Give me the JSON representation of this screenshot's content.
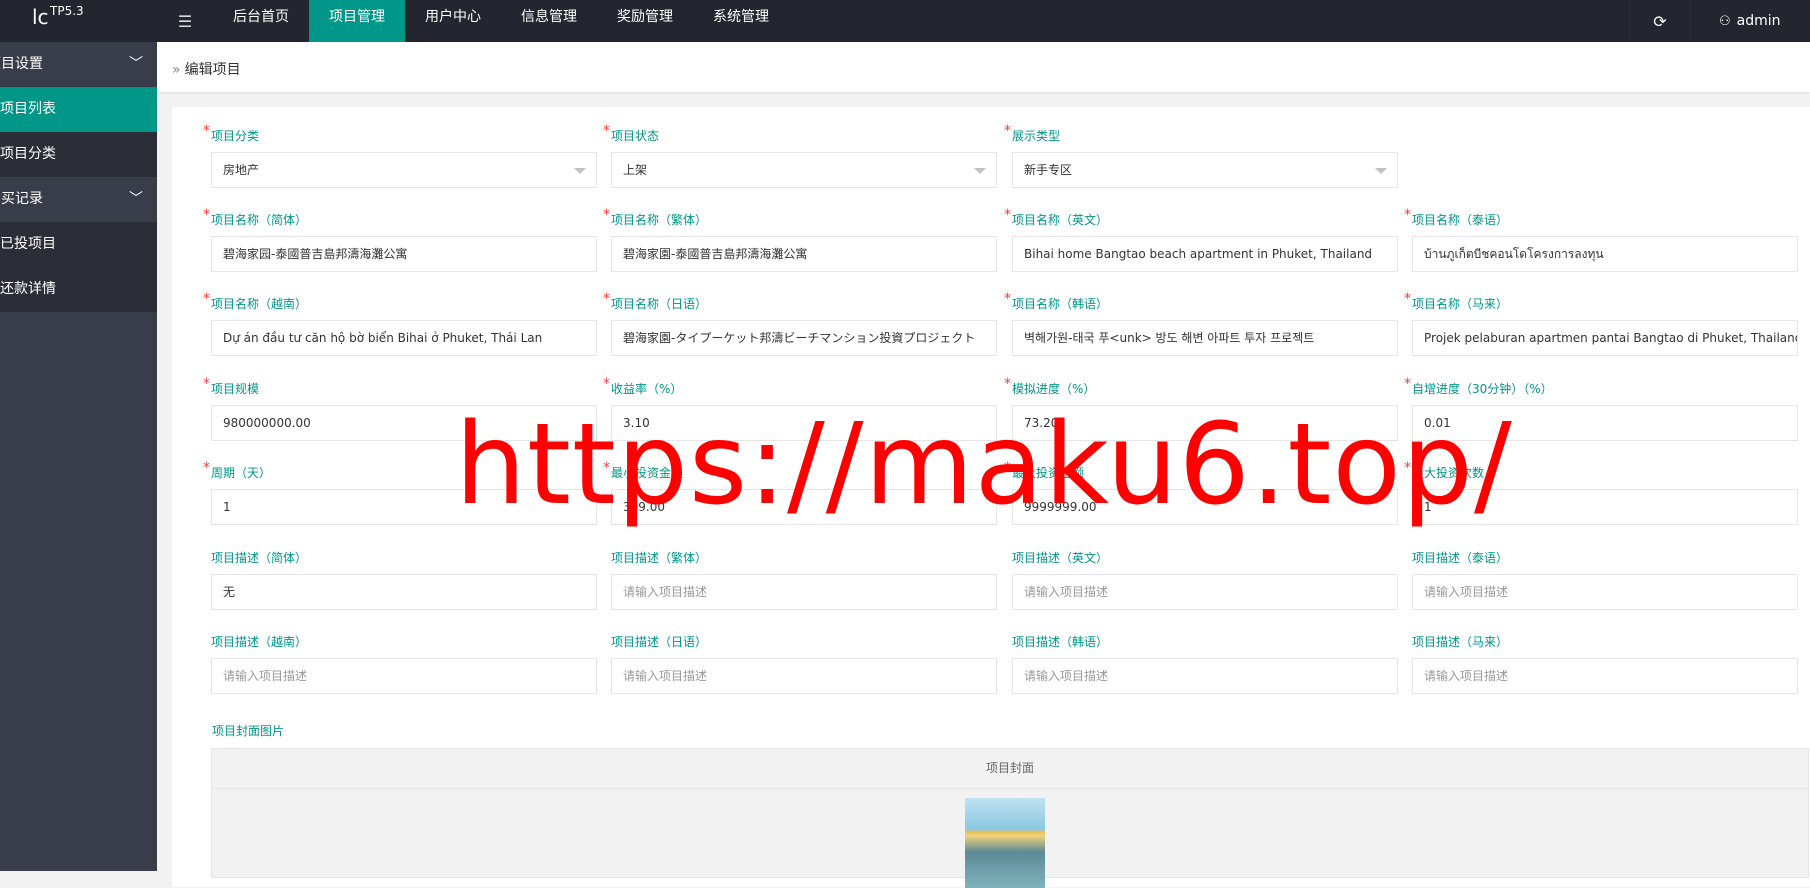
{
  "app": {
    "logo": "lc",
    "version": "TP5.3"
  },
  "topnav": {
    "items": [
      {
        "label": "后台首页",
        "active": false
      },
      {
        "label": "项目管理",
        "active": true
      },
      {
        "label": "用户中心",
        "active": false
      },
      {
        "label": "信息管理",
        "active": false
      },
      {
        "label": "奖励管理",
        "active": false
      },
      {
        "label": "系统管理",
        "active": false
      }
    ],
    "user": "admin"
  },
  "sidebar": {
    "groups": [
      {
        "label": "项目设置",
        "items": [
          {
            "label": "项目列表",
            "active": true
          },
          {
            "label": "项目分类",
            "active": false
          }
        ]
      },
      {
        "label": "购买记录",
        "items": [
          {
            "label": "已投项目",
            "active": false
          },
          {
            "label": "还款详情",
            "active": false
          }
        ]
      }
    ]
  },
  "breadcrumb": "编辑项目",
  "form": {
    "category": {
      "label": "项目分类",
      "value": "房地产"
    },
    "status": {
      "label": "项目状态",
      "value": "上架"
    },
    "display_type": {
      "label": "展示类型",
      "value": "新手专区"
    },
    "name_sc": {
      "label": "项目名称（简体）",
      "value": "碧海家园-泰國普吉島邦濤海灘公寓"
    },
    "name_tc": {
      "label": "项目名称（繁体）",
      "value": "碧海家園-泰國普吉島邦濤海灘公寓"
    },
    "name_en": {
      "label": "项目名称（英文）",
      "value": "Bihai home Bangtao beach apartment in Phuket, Thailand"
    },
    "name_th": {
      "label": "项目名称（泰语）",
      "value": "บ้านภูเก็ตบีชคอนโดโครงการลงทุน"
    },
    "name_vi": {
      "label": "项目名称（越南）",
      "value": "Dự án đầu tư căn hộ bờ biển Bihai ở Phuket, Thái Lan"
    },
    "name_ja": {
      "label": "项目名称（日语）",
      "value": "碧海家園-タイプーケット邦濤ビーチマンション投資プロジェクト"
    },
    "name_ko": {
      "label": "项目名称（韩语）",
      "value": "벽해가원-태국 푸<unk> 방도 해변 아파트 투자 프로젝트"
    },
    "name_ms": {
      "label": "项目名称（马来）",
      "value": "Projek pelaburan apartmen pantai Bangtao di Phuket, Thailand"
    },
    "scale": {
      "label": "项目规模",
      "value": "980000000.00"
    },
    "yield": {
      "label": "收益率（%）",
      "value": "3.10"
    },
    "progress": {
      "label": "模拟进度（%）",
      "value": "73.20"
    },
    "auto_progress": {
      "label": "自增进度（30分钟）（%）",
      "value": "0.01"
    },
    "period": {
      "label": "周期（天）",
      "value": "1"
    },
    "min_invest": {
      "label": "最小投资金额",
      "value": "399.00"
    },
    "max_invest": {
      "label": "最大投资金额",
      "value": "9999999.00"
    },
    "max_times": {
      "label": "最大投资次数",
      "value": "1"
    },
    "desc_sc": {
      "label": "项目描述（简体）",
      "value": "无"
    },
    "desc_tc": {
      "label": "项目描述（繁体）",
      "placeholder": "请输入项目描述"
    },
    "desc_en": {
      "label": "项目描述（英文）",
      "placeholder": "请输入项目描述"
    },
    "desc_th": {
      "label": "项目描述（泰语）",
      "placeholder": "请输入项目描述"
    },
    "desc_vi": {
      "label": "项目描述（越南）",
      "placeholder": "请输入项目描述"
    },
    "desc_ja": {
      "label": "项目描述（日语）",
      "placeholder": "请输入项目描述"
    },
    "desc_ko": {
      "label": "项目描述（韩语）",
      "placeholder": "请输入项目描述"
    },
    "desc_ms": {
      "label": "项目描述（马来）",
      "placeholder": "请输入项目描述"
    },
    "cover_label": "项目封面图片",
    "cover_header": "项目封面"
  },
  "watermark": "https://maku6.top/",
  "colors": {
    "accent": "#009688",
    "topbar": "#23262e",
    "sidebar": "#393d49",
    "required": "#ff3b30",
    "watermark": "#ff0000"
  }
}
